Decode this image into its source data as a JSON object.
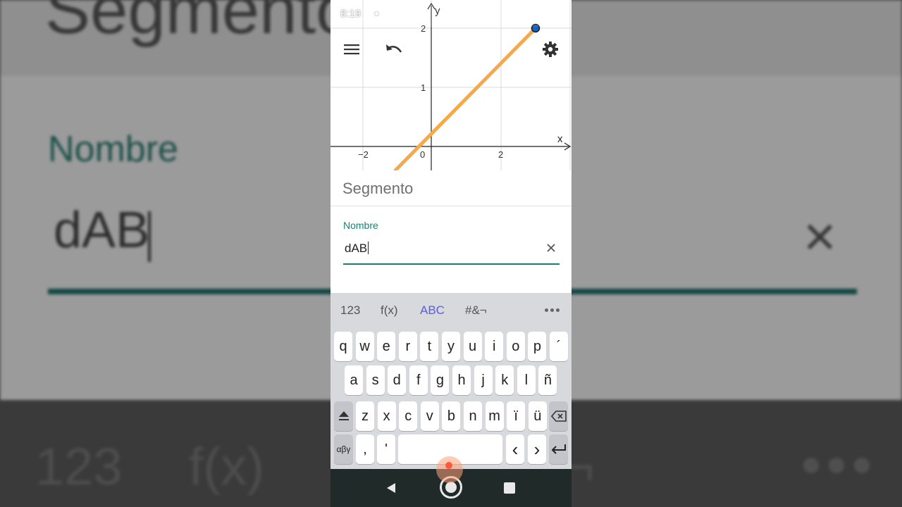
{
  "background": {
    "top_text": "Segmento",
    "label": "Nombre",
    "input_value": "dAB",
    "clear_glyph": "×",
    "kb_tab_1": "123",
    "kb_tab_2": "f(x)",
    "kb_tab_3": "¬"
  },
  "status_bar": {
    "time": "8:19",
    "icons": [
      "wifi-icon",
      "signal-icon",
      "battery-icon"
    ]
  },
  "graph": {
    "x_axis_label": "x",
    "y_axis_label": "y",
    "x_ticks": [
      "−2",
      "0",
      "2"
    ],
    "y_ticks": [
      "1",
      "2"
    ],
    "segment_color": "#f5a94a",
    "point_color": "#1565c0"
  },
  "toolbar": {
    "menu_icon": "menu-icon",
    "undo_icon": "undo-icon",
    "settings_icon": "gear-icon"
  },
  "properties": {
    "title": "Segmento",
    "field_label": "Nombre",
    "field_value": "dAB",
    "clear_glyph": "×",
    "accent_color": "#1a7f72"
  },
  "keyboard": {
    "tabs": [
      "123",
      "f(x)",
      "ABC",
      "#&¬"
    ],
    "active_tab": "ABC",
    "row1": [
      "q",
      "w",
      "e",
      "r",
      "t",
      "y",
      "u",
      "i",
      "o",
      "p",
      "´"
    ],
    "row2": [
      "a",
      "s",
      "d",
      "f",
      "g",
      "h",
      "j",
      "k",
      "l",
      "ñ"
    ],
    "row3": [
      "z",
      "x",
      "c",
      "v",
      "b",
      "n",
      "m",
      "ï",
      "ü"
    ],
    "greek_label": "αβγ",
    "comma": ",",
    "apostrophe": "'",
    "left_arrow": "‹",
    "right_arrow": "›"
  }
}
